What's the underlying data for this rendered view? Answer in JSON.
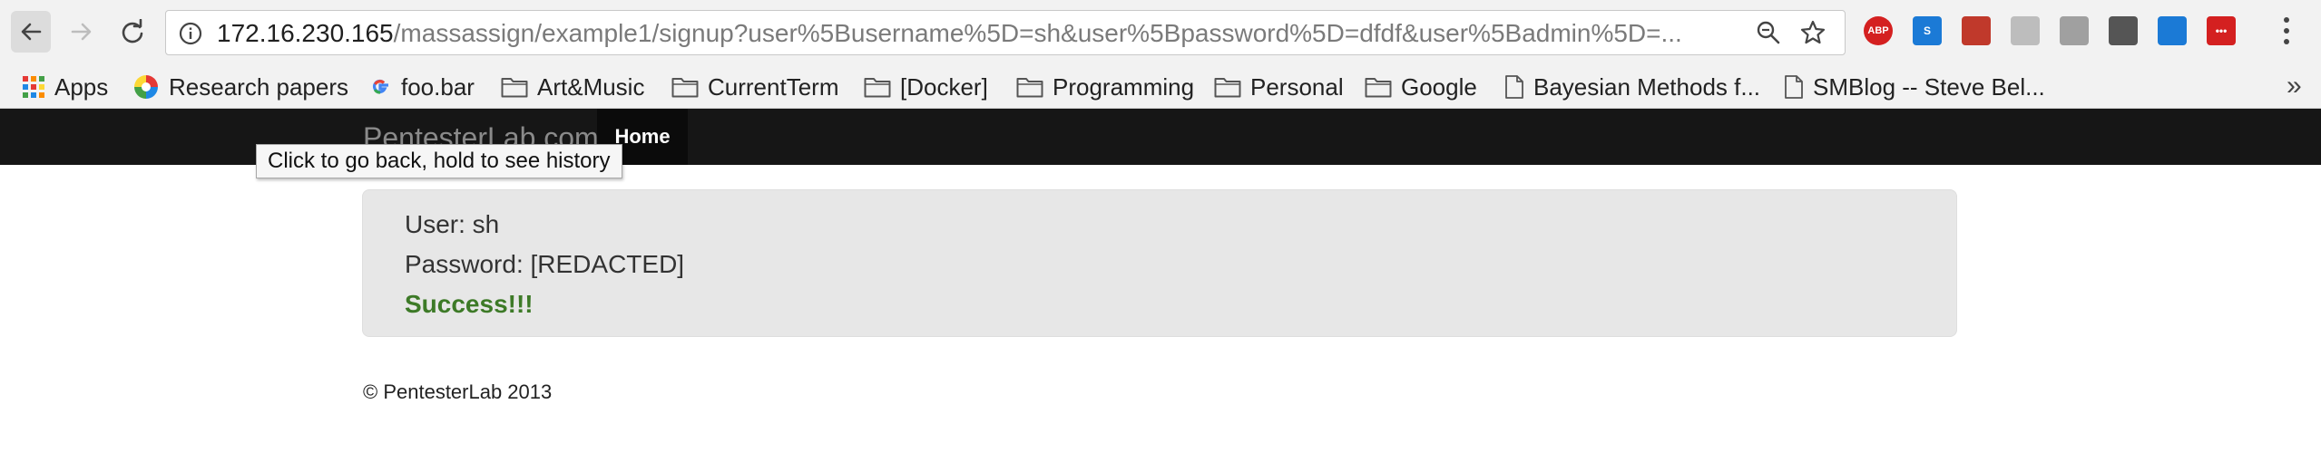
{
  "browser": {
    "url_host": "172.16.230.165",
    "url_path": "/massassign/example1/signup?user%5Busername%5D=sh&user%5Bpassword%5D=dfdf&user%5Badmin%5D=...",
    "extensions": [
      {
        "name": "adblock-plus-icon",
        "label": "ABP",
        "color": "#d42020"
      },
      {
        "name": "scrible-icon",
        "label": "S",
        "color": "#1b7ad6"
      },
      {
        "name": "bookmark-ext-icon",
        "label": "",
        "color": "#c0392b"
      },
      {
        "name": "ublock-icon",
        "label": "",
        "color": "#bdbdbd"
      },
      {
        "name": "drive-icon",
        "label": "",
        "color": "#a0a0a0"
      },
      {
        "name": "lightbulb-icon",
        "label": "",
        "color": "#555555"
      },
      {
        "name": "share-icon",
        "label": "",
        "color": "#1b7ad6"
      },
      {
        "name": "lastpass-icon",
        "label": "•••",
        "color": "#d42020"
      }
    ]
  },
  "bookmarks": {
    "items": [
      {
        "label": "Apps",
        "icon": "apps-grid-icon"
      },
      {
        "label": "Research papers",
        "icon": "photos-icon"
      },
      {
        "label": "foo.bar",
        "icon": "google-icon"
      },
      {
        "label": "Art&Music",
        "icon": "folder-icon"
      },
      {
        "label": "CurrentTerm",
        "icon": "folder-icon"
      },
      {
        "label": "[Docker]",
        "icon": "folder-icon"
      },
      {
        "label": "Programming",
        "icon": "folder-icon"
      },
      {
        "label": "Personal",
        "icon": "folder-icon"
      },
      {
        "label": "Google",
        "icon": "folder-icon"
      },
      {
        "label": "Bayesian Methods f...",
        "icon": "page-icon"
      },
      {
        "label": "SMBlog -- Steve Bel...",
        "icon": "page-icon"
      }
    ],
    "more": "»"
  },
  "tooltip": "Click to go back, hold to see history",
  "navbar": {
    "brand": "PentesterLab.com",
    "home": "Home"
  },
  "result": {
    "user": "User: sh",
    "password": "Password: [REDACTED]",
    "status": "Success!!!"
  },
  "footer": "© PentesterLab 2013",
  "colors": {
    "navbar": "#161616",
    "well": "#e7e7e7",
    "success": "#3d7a27"
  }
}
